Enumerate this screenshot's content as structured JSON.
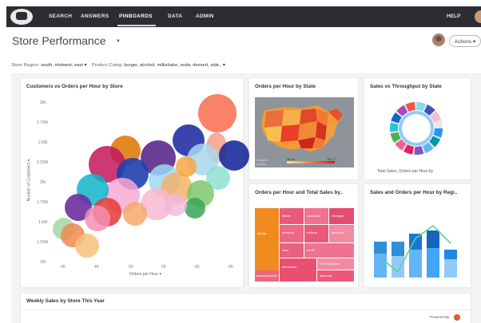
{
  "nav": {
    "items": [
      "SEARCH",
      "ANSWERS",
      "PINBOARDS",
      "DATA",
      "ADMIN"
    ],
    "active": "PINBOARDS",
    "help": "HELP"
  },
  "page": {
    "title": "Store Performance",
    "actions_label": "Actions ▾"
  },
  "filters": {
    "region_label": "Store Region:",
    "region_value": "south, midwest, east ▾",
    "category_label": "Product Categ.",
    "category_value": "burger, alcohol, milkshake, soda, dessert, side.. ▾"
  },
  "cards": {
    "bubble_title": "Customers vs Orders per Hour by Store",
    "map_title": "Orders per Hour by State",
    "donut_title": "Sales vs Throughput by State",
    "donut_caption": "Total Sales, Orders per Hour by",
    "treemap_title": "Orders per Hour and Total Sales by..",
    "bars_title": "Sales and Orders per Hour by Regi..",
    "weekly_title": "Weekly Sales by Store This Year"
  },
  "map": {
    "legend_min": "45.69",
    "legend_max": "191.77"
  },
  "bubble_axes": {
    "ylabel": "Number of Customers",
    "xlabel": "Orders per Hour",
    "yticks": [
      "3M",
      "2.75M",
      "2.5M",
      "2.25M",
      "2M",
      "1.75M",
      "1.5M",
      "1.25M",
      "1M"
    ],
    "xticks": [
      "40",
      "45",
      "50",
      "55",
      "60",
      "65"
    ]
  },
  "treemap_labels": [
    "illinois",
    "wisconsin",
    "michigan",
    "florida",
    "missouri",
    "indiana",
    "kentucky",
    "iowa",
    "south",
    "tennessee",
    "north carolina",
    "massachusetts",
    "alabama"
  ],
  "footer": {
    "powered_by": "Powered By"
  },
  "colors": {
    "nav_bg": "#2b2d33",
    "accent": "#e05a30",
    "treemap_orange": "#f08a1f",
    "treemap_pink": "#ea5a78",
    "bar_blue": "#2f8fd8",
    "line_green": "#5ccf9a"
  }
}
